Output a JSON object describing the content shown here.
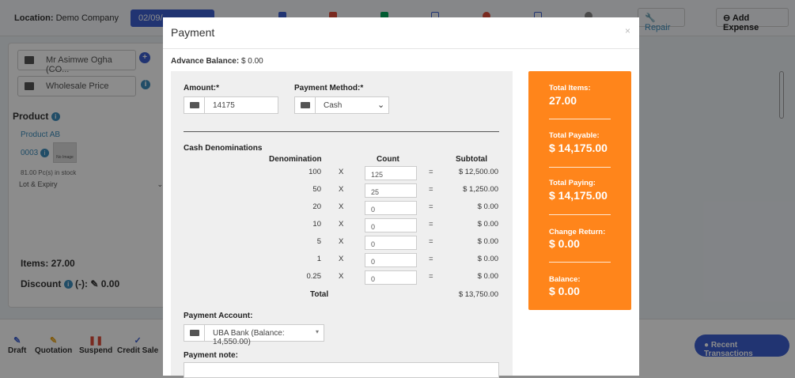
{
  "topbar": {
    "location_label": "Location:",
    "location_value": "Demo Company",
    "date_value": "02/09/",
    "repair_label": "Repair",
    "add_expense_label": "Add Expense"
  },
  "left": {
    "customer": "Mr Asimwe Ogha (CO...",
    "price_group": "Wholesale Price",
    "product_heading": "Product",
    "product_name": "Product AB",
    "product_code": "0003",
    "thumb_text": "No Image",
    "stock_text": "81.00 Pc(s) in stock",
    "lot_select": "Lot & Expiry",
    "items_text": "Items: 27.00",
    "discount_text": "Discount",
    "discount_suffix": "(-):",
    "discount_value": "0.00"
  },
  "bottombar": {
    "draft": "Draft",
    "quotation": "Quotation",
    "suspend": "Suspend",
    "credit_sale": "Credit Sale",
    "recent_transactions": "Recent Transactions"
  },
  "modal": {
    "title": "Payment",
    "close": "×",
    "advance_label": "Advance Balance:",
    "advance_value": "$ 0.00",
    "amount_label": "Amount:*",
    "amount_value": "14175",
    "method_label": "Payment Method:*",
    "method_value": "Cash",
    "denominations_heading": "Cash Denominations",
    "col_denomination": "Denomination",
    "col_count": "Count",
    "col_subtotal": "Subtotal",
    "x_symbol": "X",
    "eq_symbol": "=",
    "rows": [
      {
        "denomination": "100",
        "count": "125",
        "subtotal": "$ 12,500.00"
      },
      {
        "denomination": "50",
        "count": "25",
        "subtotal": "$ 1,250.00"
      },
      {
        "denomination": "20",
        "count": "0",
        "subtotal": "$ 0.00"
      },
      {
        "denomination": "10",
        "count": "0",
        "subtotal": "$ 0.00"
      },
      {
        "denomination": "5",
        "count": "0",
        "subtotal": "$ 0.00"
      },
      {
        "denomination": "1",
        "count": "0",
        "subtotal": "$ 0.00"
      },
      {
        "denomination": "0.25",
        "count": "0",
        "subtotal": "$ 0.00"
      }
    ],
    "total_label": "Total",
    "total_value": "$ 13,750.00",
    "account_label": "Payment Account:",
    "account_value": "UBA Bank (Balance: 14,550.00)",
    "note_label": "Payment note:"
  },
  "summary": {
    "total_items_label": "Total Items:",
    "total_items_value": "27.00",
    "total_payable_label": "Total Payable:",
    "total_payable_value": "$ 14,175.00",
    "total_paying_label": "Total Paying:",
    "total_paying_value": "$ 14,175.00",
    "change_return_label": "Change Return:",
    "change_return_value": "$ 0.00",
    "balance_label": "Balance:",
    "balance_value": "$ 0.00"
  },
  "colors": {
    "accent": "#3c5fcf",
    "summary_bg": "#ff851b",
    "link": "#3c8dbc"
  }
}
